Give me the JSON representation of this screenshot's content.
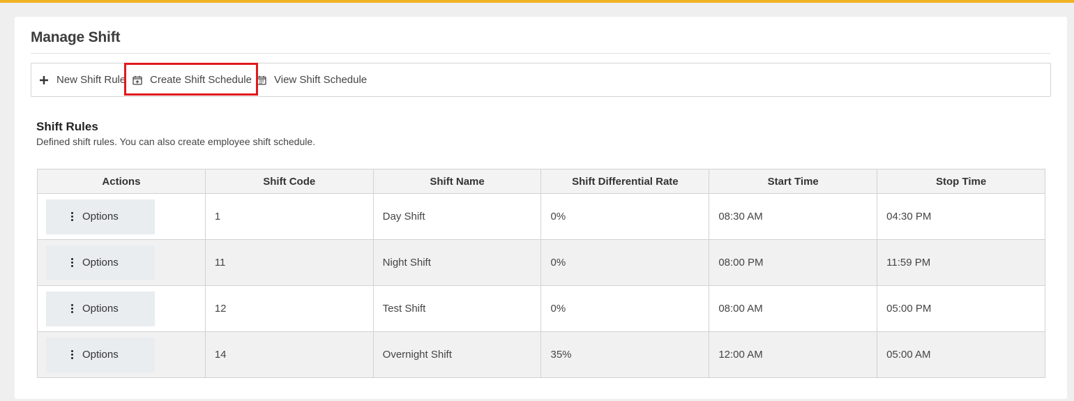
{
  "page": {
    "title": "Manage Shift",
    "accent_color": "#f0b323",
    "highlight_color": "#e0191c"
  },
  "toolbar": {
    "new_rule": {
      "label": "New Shift Rule",
      "icon": "plus-icon"
    },
    "create_schedule": {
      "label": "Create Shift Schedule",
      "icon": "calendar-plus-icon"
    },
    "view_schedule": {
      "label": "View Shift Schedule",
      "icon": "calendar-icon"
    }
  },
  "section": {
    "title": "Shift Rules",
    "description": "Defined shift rules. You can also create employee shift schedule."
  },
  "table": {
    "headers": [
      "Actions",
      "Shift Code",
      "Shift Name",
      "Shift Differential Rate",
      "Start Time",
      "Stop Time"
    ],
    "options_label": "Options",
    "rows": [
      {
        "code": "1",
        "name": "Day Shift",
        "rate": "0%",
        "start": "08:30 AM",
        "stop": "04:30 PM"
      },
      {
        "code": "11",
        "name": "Night Shift",
        "rate": "0%",
        "start": "08:00 PM",
        "stop": "11:59 PM"
      },
      {
        "code": "12",
        "name": "Test Shift",
        "rate": "0%",
        "start": "08:00 AM",
        "stop": "05:00 PM"
      },
      {
        "code": "14",
        "name": "Overnight Shift",
        "rate": "35%",
        "start": "12:00 AM",
        "stop": "05:00 AM"
      }
    ]
  }
}
